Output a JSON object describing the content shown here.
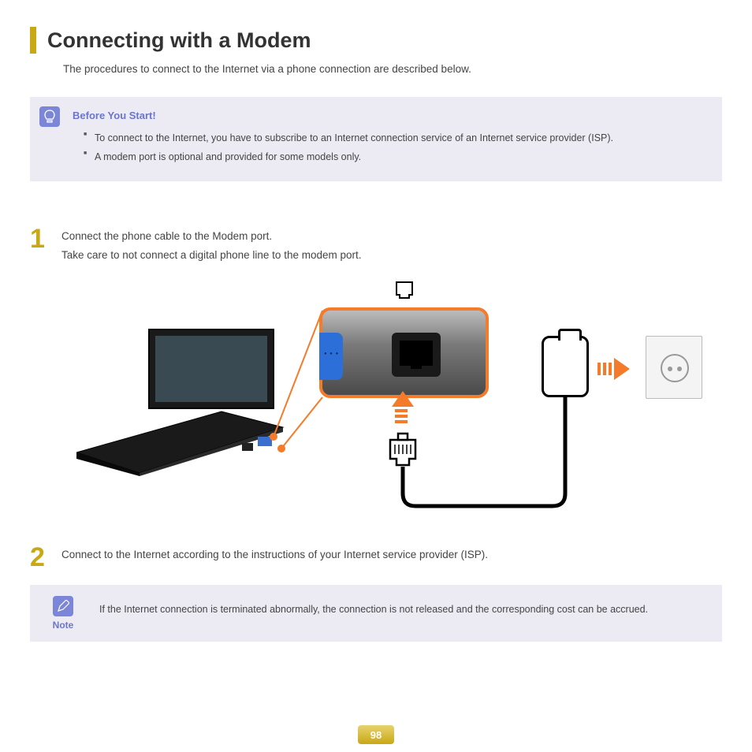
{
  "header": {
    "title": "Connecting with a Modem",
    "subtitle": "The procedures to connect to the Internet via a phone connection are described below."
  },
  "before_box": {
    "heading": "Before You Start!",
    "items": [
      "To connect to the Internet, you have to subscribe to an Internet connection service of an Internet service provider (ISP).",
      "A modem port is optional and provided for some models only."
    ]
  },
  "steps": {
    "one": {
      "num": "1",
      "line1": "Connect the phone cable to the Modem port.",
      "line2": "Take care to not connect a digital phone line to the modem port."
    },
    "two": {
      "num": "2",
      "text": "Connect to the Internet according to the instructions of your Internet service provider (ISP)."
    }
  },
  "note": {
    "label": "Note",
    "text": "If the Internet connection is terminated abnormally, the connection is not released and the corresponding cost can be accrued."
  },
  "page_number": "98"
}
